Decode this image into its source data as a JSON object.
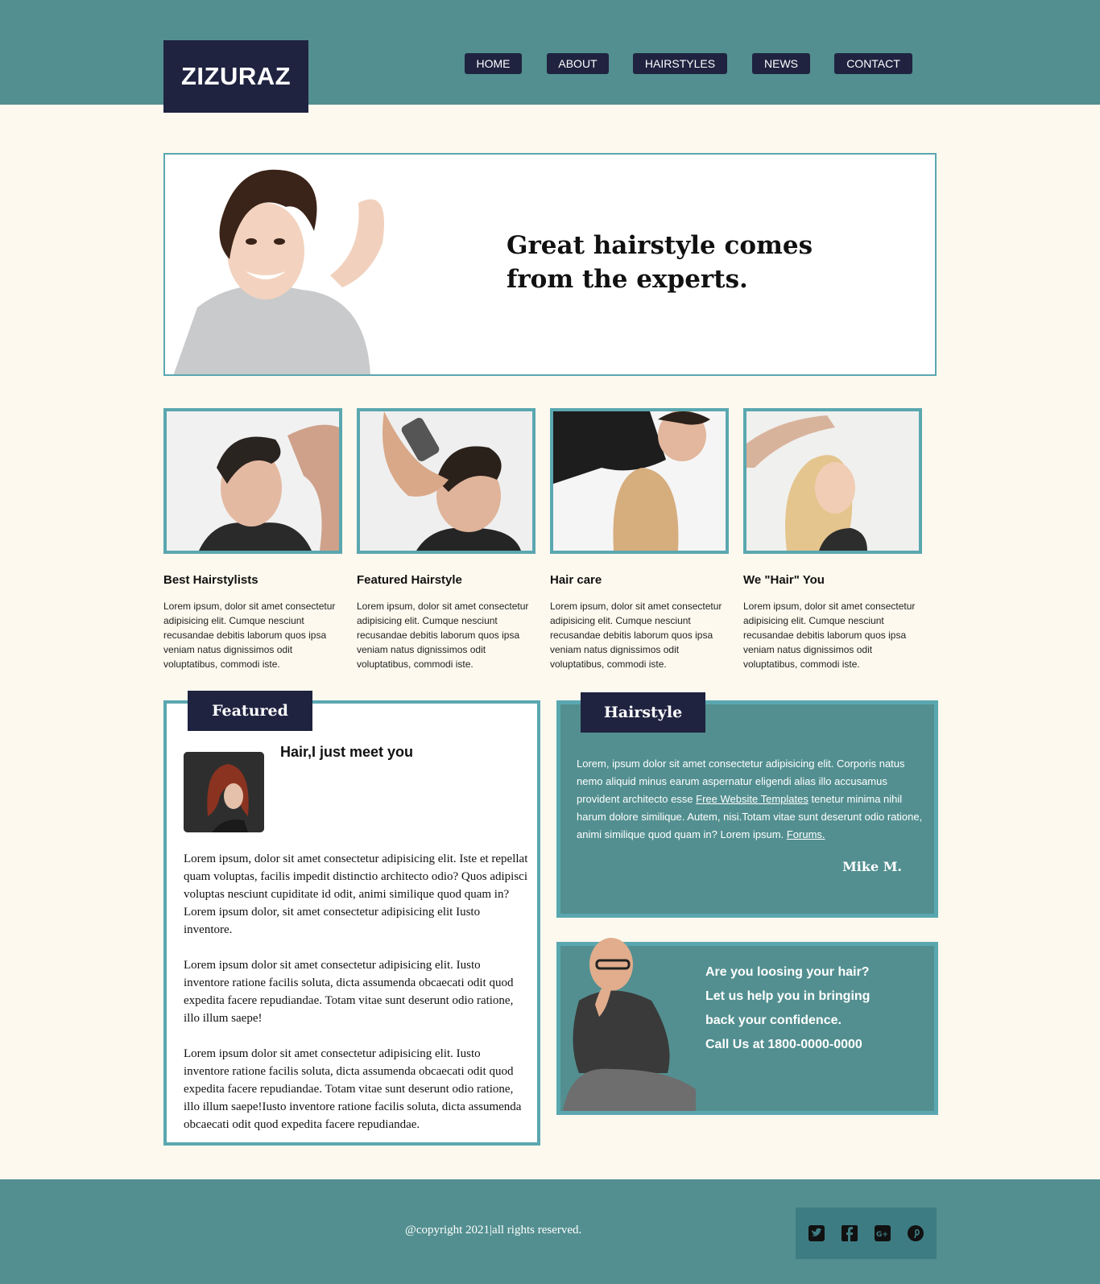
{
  "brand": {
    "logo": "ZIZURAZ"
  },
  "nav": {
    "items": [
      {
        "label": "HOME"
      },
      {
        "label": "ABOUT"
      },
      {
        "label": "HAIRSTYLES"
      },
      {
        "label": "NEWS"
      },
      {
        "label": "CONTACT"
      }
    ]
  },
  "hero": {
    "line1": "Great hairstyle comes",
    "line2": "from the experts."
  },
  "cards": [
    {
      "title": "Best Hairstylists",
      "text": "Lorem ipsum, dolor sit amet consectetur adipisicing elit. Cumque nesciunt recusandae debitis laborum quos ipsa veniam natus dignissimos odit voluptatibus, commodi iste."
    },
    {
      "title": "Featured Hairstyle",
      "text": "Lorem ipsum, dolor sit amet consectetur adipisicing elit. Cumque nesciunt recusandae debitis laborum quos ipsa veniam natus dignissimos odit voluptatibus, commodi iste."
    },
    {
      "title": "Hair care",
      "text": "Lorem ipsum, dolor sit amet consectetur adipisicing elit. Cumque nesciunt recusandae debitis laborum quos ipsa veniam natus dignissimos odit voluptatibus, commodi iste."
    },
    {
      "title": "We \"Hair\" You",
      "text": "Lorem ipsum, dolor sit amet consectetur adipisicing elit. Cumque nesciunt recusandae debitis laborum quos ipsa veniam natus dignissimos odit voluptatibus, commodi iste."
    }
  ],
  "featured": {
    "tab": "Featured",
    "heading": "Hair,I just meet you",
    "paragraphs": [
      "Lorem ipsum, dolor sit amet consectetur adipisicing elit. Iste et repellat quam voluptas, facilis impedit distinctio architecto odio? Quos adipisci voluptas nesciunt cupiditate id odit, animi similique quod quam in? Lorem ipsum dolor, sit amet consectetur adipisicing elit Iusto inventore.",
      "Lorem ipsum dolor sit amet consectetur adipisicing elit. Iusto inventore ratione facilis soluta, dicta assumenda obcaecati odit quod expedita facere repudiandae. Totam vitae sunt deserunt odio ratione, illo illum saepe!",
      "Lorem ipsum dolor sit amet consectetur adipisicing elit. Iusto inventore ratione facilis soluta, dicta assumenda obcaecati odit quod expedita facere repudiandae. Totam vitae sunt deserunt odio ratione, illo illum saepe!Iusto inventore ratione facilis soluta, dicta assumenda obcaecati odit quod expedita facere repudiandae."
    ]
  },
  "hairstyle": {
    "tab": "Hairstyle",
    "text_before_link": "Lorem, ipsum dolor sit amet consectetur adipisicing elit. Corporis natus nemo aliquid minus earum aspernatur eligendi alias illo accusamus provident architecto esse ",
    "link1": "Free Website Templates",
    "text_middle": " tenetur minima nihil harum dolore similique. Autem, nisi.Totam vitae sunt deserunt odio ratione, animi similique quod quam in? Lorem ipsum. ",
    "link2": "Forums.",
    "author": "Mike M."
  },
  "promo": {
    "line1": "Are you loosing your hair?",
    "line2": "Let us help you in bringing",
    "line3": "back your confidence.",
    "line4": "Call Us at 1800-0000-0000"
  },
  "footer": {
    "copyright": "@copyright 2021|all rights reserved.",
    "social_icons": [
      "twitter-icon",
      "facebook-icon",
      "google-plus-icon",
      "pinterest-icon"
    ]
  },
  "colors": {
    "teal": "#538f90",
    "border": "#5aa7b0",
    "navy": "#1f2340",
    "cream": "#fdf9ee"
  }
}
